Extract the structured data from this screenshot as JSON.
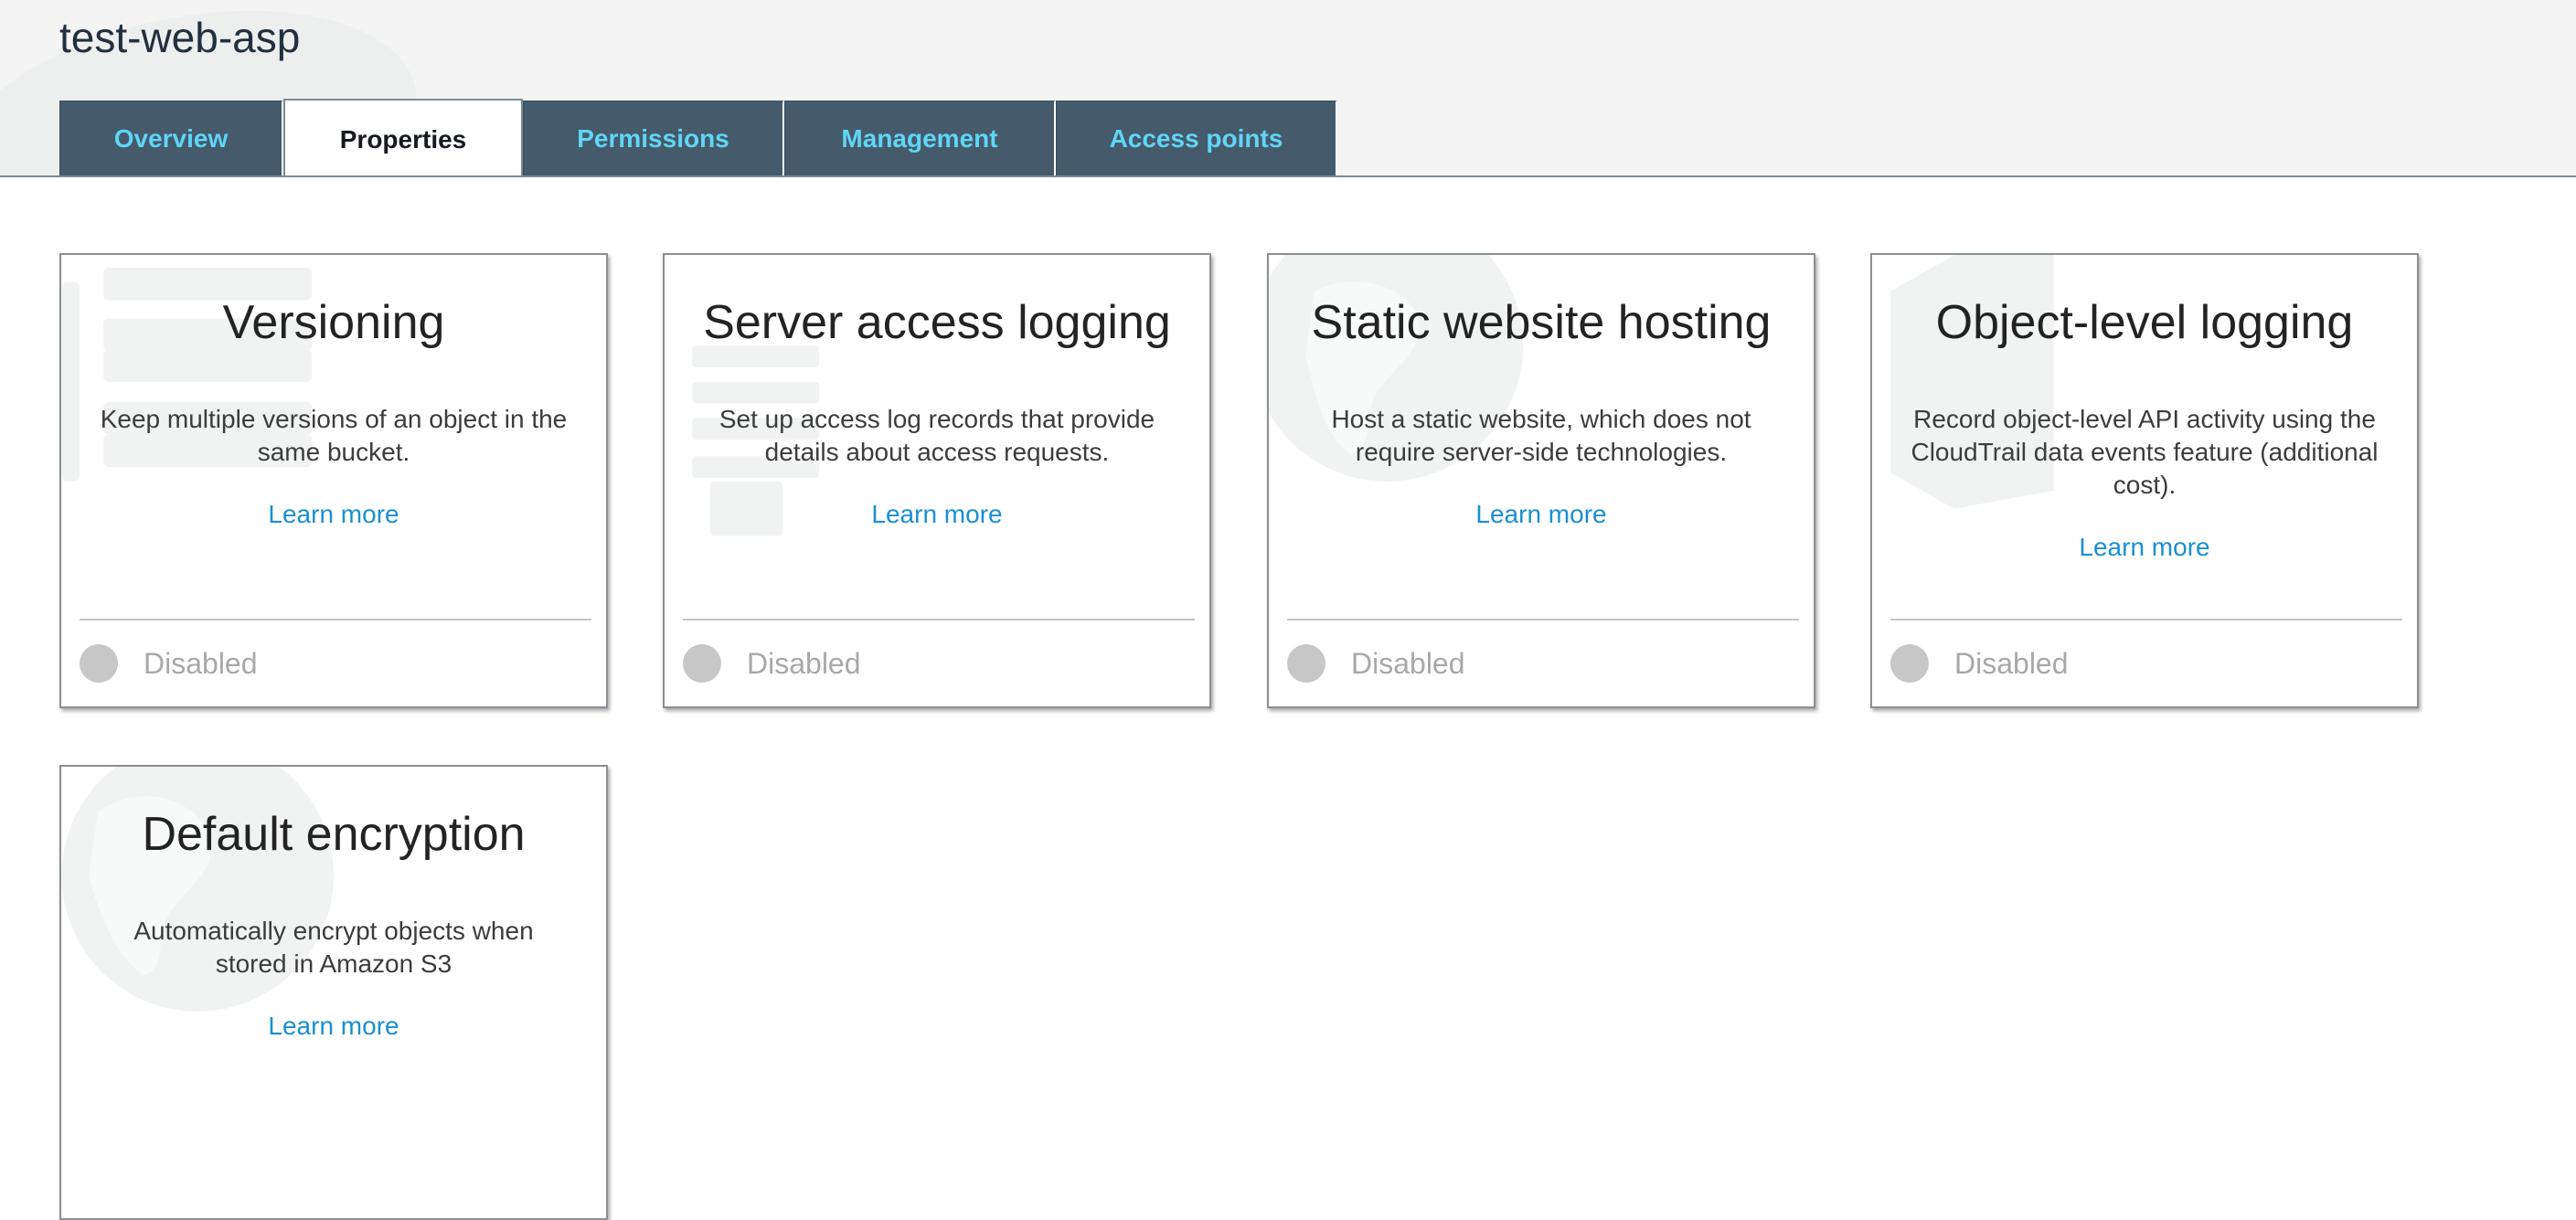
{
  "bucket": {
    "name": "test-web-asp"
  },
  "tabs": [
    {
      "label": "Overview",
      "active": false
    },
    {
      "label": "Properties",
      "active": true
    },
    {
      "label": "Permissions",
      "active": false
    },
    {
      "label": "Management",
      "active": false
    },
    {
      "label": "Access points",
      "active": false
    }
  ],
  "cards": [
    {
      "title": "Versioning",
      "description": "Keep multiple versions of an object in the same bucket.",
      "link": "Learn more",
      "status": "Disabled",
      "watermark_icon": "list-icon"
    },
    {
      "title": "Server access logging",
      "description": "Set up access log records that provide details about access requests.",
      "link": "Learn more",
      "status": "Disabled",
      "watermark_icon": "log-list-icon"
    },
    {
      "title": "Static website hosting",
      "description": "Host a static website, which does not require server-side technologies.",
      "link": "Learn more",
      "status": "Disabled",
      "watermark_icon": "globe-icon"
    },
    {
      "title": "Object-level logging",
      "description": "Record object-level API activity using the CloudTrail data events feature (additional cost).",
      "link": "Learn more",
      "status": "Disabled",
      "watermark_icon": "shield-icon"
    },
    {
      "title": "Default encryption",
      "description": "Automatically encrypt objects when stored in Amazon S3",
      "link": "Learn more",
      "status": "",
      "watermark_icon": "globe-icon"
    }
  ],
  "colors": {
    "tab_bg": "#455a6b",
    "tab_text": "#5fd6f5",
    "link": "#1a8fd4",
    "status_dot": "#c7c7c7"
  }
}
